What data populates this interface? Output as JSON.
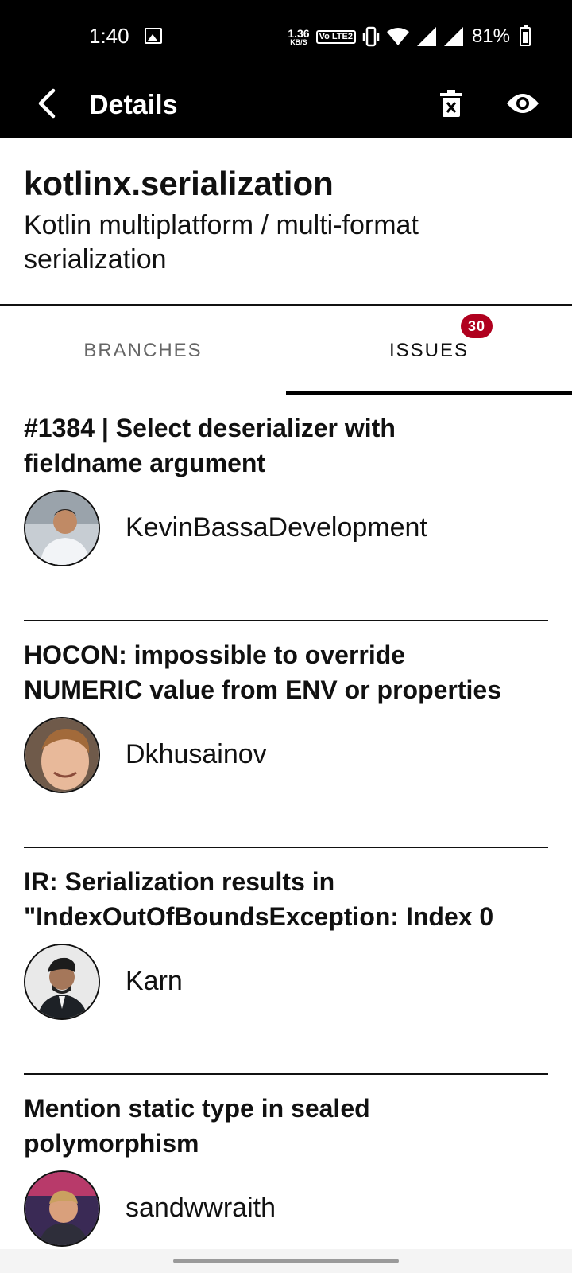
{
  "status_bar": {
    "time": "1:40",
    "net_speed_value": "1.36",
    "net_speed_unit": "KB/S",
    "volte": "Vo LTE2",
    "battery_percent": "81%",
    "icons": [
      "image-icon",
      "vibrate-icon",
      "wifi-icon",
      "signal-icon",
      "signal-icon",
      "battery-icon"
    ]
  },
  "app_bar": {
    "title": "Details",
    "actions": [
      "delete-icon",
      "eye-icon"
    ]
  },
  "repo": {
    "name": "kotlinx.serialization",
    "description": "Kotlin multiplatform / multi-format serialization"
  },
  "tabs": {
    "branches_label": "BRANCHES",
    "issues_label": "ISSUES",
    "issues_badge": "30",
    "selected": "ISSUES"
  },
  "issues": [
    {
      "title_line1": "#1384 | Select deserializer with",
      "title_line2": "fieldname argument",
      "author": "KevinBassaDevelopment"
    },
    {
      "title_line1": "HOCON: impossible to override",
      "title_line2": "NUMERIC value from ENV or properties",
      "author": "Dkhusainov"
    },
    {
      "title_line1": "IR: Serialization results in",
      "title_line2": "\"IndexOutOfBoundsException: Index 0",
      "author": "Karn"
    },
    {
      "title_line1": "Mention static type in sealed",
      "title_line2": "polymorphism",
      "author": "sandwwraith"
    }
  ],
  "colors": {
    "bar_background": "#000000",
    "badge": "#b0001e",
    "tab_inactive": "#666666",
    "text": "#111111"
  }
}
